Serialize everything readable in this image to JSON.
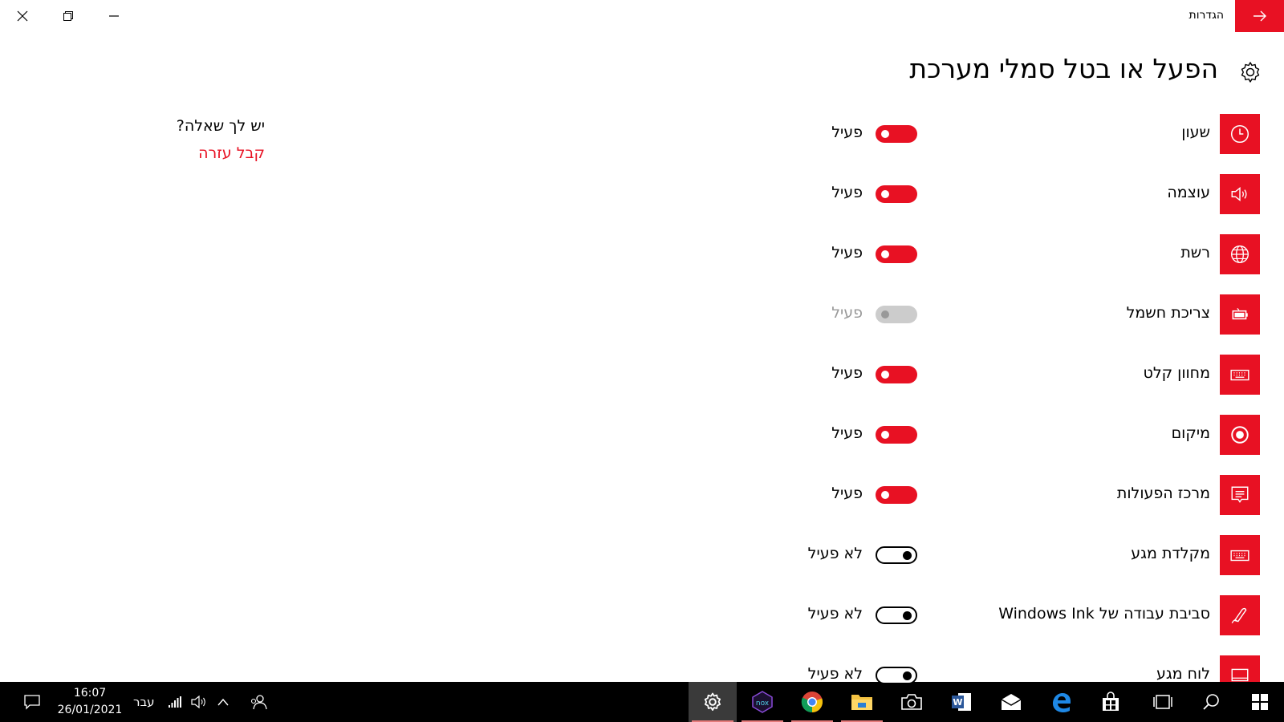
{
  "window": {
    "app_name": "הגדרות"
  },
  "page": {
    "title": "הפעל או בטל סמלי מערכת"
  },
  "items": [
    {
      "label": "שעון",
      "state": "פעיל",
      "toggle": "on"
    },
    {
      "label": "עוצמה",
      "state": "פעיל",
      "toggle": "on"
    },
    {
      "label": "רשת",
      "state": "פעיל",
      "toggle": "on"
    },
    {
      "label": "צריכת חשמל",
      "state": "פעיל",
      "toggle": "disabled"
    },
    {
      "label": "מחוון קלט",
      "state": "פעיל",
      "toggle": "on"
    },
    {
      "label": "מיקום",
      "state": "פעיל",
      "toggle": "on"
    },
    {
      "label": "מרכז הפעולות",
      "state": "פעיל",
      "toggle": "on"
    },
    {
      "label": "מקלדת מגע",
      "state": "לא פעיל",
      "toggle": "off"
    },
    {
      "label": "סביבת עבודה של Windows Ink",
      "state": "לא פעיל",
      "toggle": "off"
    },
    {
      "label": "לוח מגע",
      "state": "לא פעיל",
      "toggle": "off"
    }
  ],
  "help": {
    "question": "יש לך שאלה?",
    "link": "קבל עזרה"
  },
  "taskbar": {
    "time": "16:07",
    "date": "26/01/2021",
    "language": "עבר"
  },
  "colors": {
    "accent": "#e81123",
    "taskbar_bg": "#000000"
  }
}
